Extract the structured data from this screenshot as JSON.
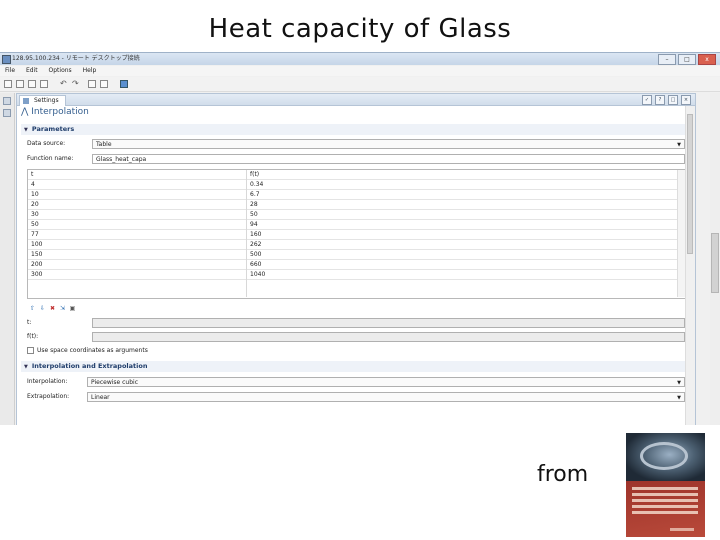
{
  "slide": {
    "title": "Heat capacity of Glass",
    "from_label": "from"
  },
  "window": {
    "title": "128.95.100.234 - リモート デスクトップ接続",
    "buttons": {
      "minimize": "–",
      "maximize": "□",
      "close": "x"
    }
  },
  "menu": [
    "File",
    "Edit",
    "Options",
    "Help"
  ],
  "settings": {
    "tab_label": "Settings",
    "panel_title": "Interpolation",
    "parameters_section": "Parameters",
    "data_source_label": "Data source:",
    "data_source_value": "Table",
    "function_name_label": "Function name:",
    "function_name_value": "Glass_heat_capa",
    "table": {
      "headers": [
        "t",
        "f(t)"
      ],
      "rows": [
        [
          "4",
          "0.34"
        ],
        [
          "10",
          "6.7"
        ],
        [
          "20",
          "28"
        ],
        [
          "30",
          "50"
        ],
        [
          "50",
          "94"
        ],
        [
          "77",
          "160"
        ],
        [
          "100",
          "262"
        ],
        [
          "150",
          "500"
        ],
        [
          "200",
          "660"
        ],
        [
          "300",
          "1040"
        ]
      ]
    },
    "t_label": "t:",
    "ft_label": "f(t):",
    "space_coords_label": "Use space coordinates as arguments",
    "interp_section": "Interpolation and Extrapolation",
    "interpolation_label": "Interpolation:",
    "interpolation_value": "Piecewise cubic",
    "extrapolation_label": "Extrapolation:",
    "extrapolation_value": "Linear"
  },
  "icons": {
    "tab_tools": [
      "pin-icon",
      "help-icon",
      "max-icon",
      "close-icon"
    ],
    "table_tools": [
      "arrow-up-icon",
      "arrow-down-icon",
      "delete-icon",
      "import-icon",
      "save-icon"
    ]
  },
  "book_cover": {
    "colors": {
      "cover": "#a0352c",
      "text": "#f2d7c9"
    }
  }
}
